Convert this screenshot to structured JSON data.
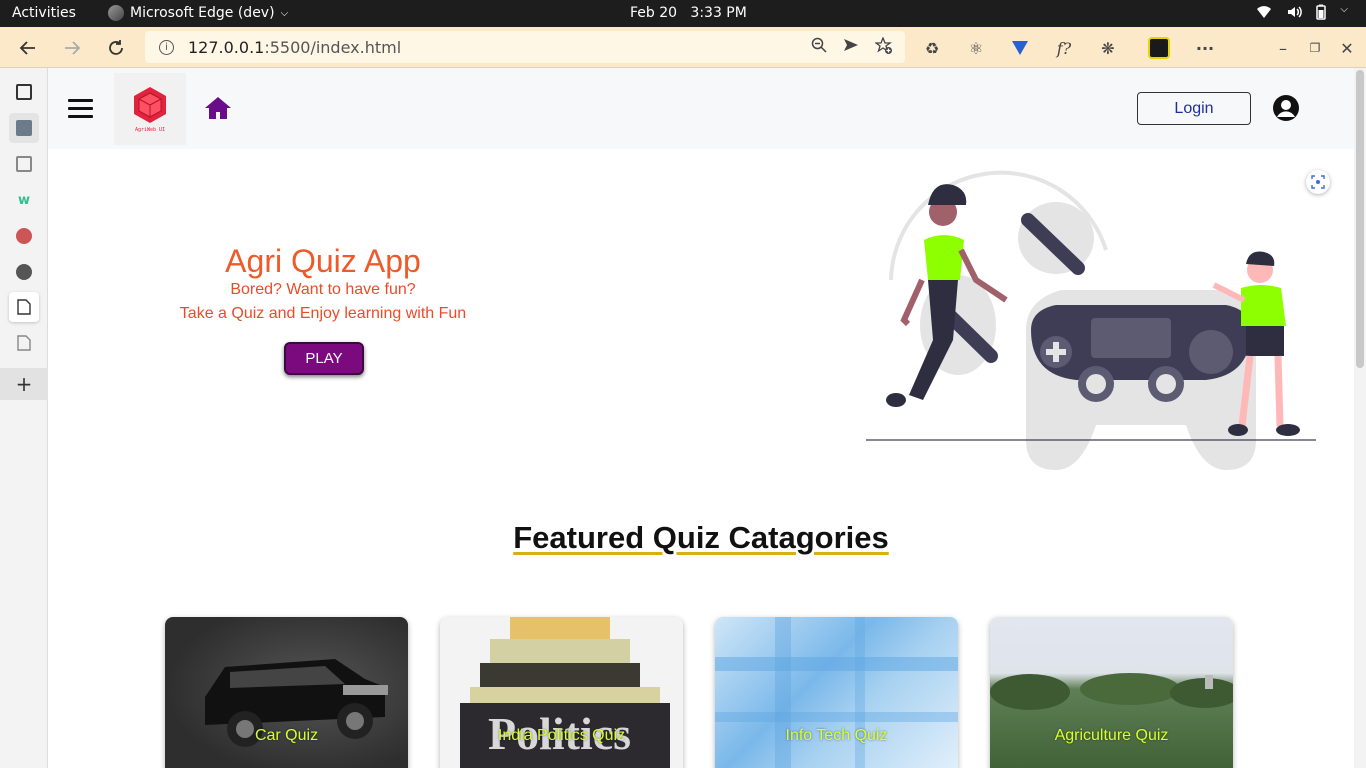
{
  "os": {
    "activities": "Activities",
    "app_name": "Microsoft Edge (dev)",
    "date": "Feb 20",
    "time": "3:33 PM"
  },
  "browser": {
    "url_host": "127.0.0.1",
    "url_path": ":5500/index.html"
  },
  "nav": {
    "logo_text": "AgriWeb UI",
    "login_label": "Login"
  },
  "hero": {
    "title": "Agri Quiz App",
    "subtitle_1": "Bored? Want to have fun?",
    "subtitle_2": "Take a Quiz and Enjoy learning with Fun",
    "play_label": "PLAY"
  },
  "featured": {
    "heading": "Featured Quiz Catagories",
    "cards": [
      {
        "label": "Car Quiz"
      },
      {
        "label": "India Politics Quiz"
      },
      {
        "label": "Info Tech Quiz"
      },
      {
        "label": "Agriculture Quiz"
      }
    ]
  },
  "colors": {
    "accent_orange": "#f05a28",
    "play_purple": "#7b0a7f",
    "card_label": "#d8ff2a",
    "figure_green": "#8eff00"
  }
}
